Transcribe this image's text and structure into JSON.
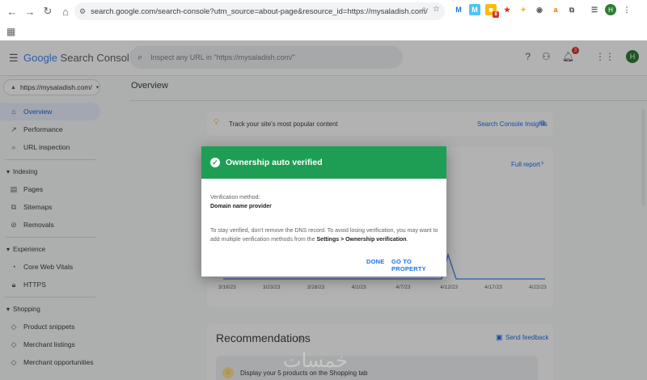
{
  "browser": {
    "url": "search.google.com/search-console?utm_source=about-page&resource_id=https://mysaladish.com/",
    "profile_initial": "H",
    "extension_badge": "8"
  },
  "app": {
    "logo_google": "Google",
    "logo_product": "Search Console",
    "search_placeholder": "Inspect any URL in \"https://mysaladish.com/\"",
    "notification_count": "3",
    "user_initial": "H"
  },
  "sidebar": {
    "property": "https://mysaladish.com/",
    "items": [
      {
        "label": "Overview"
      },
      {
        "label": "Performance"
      },
      {
        "label": "URL inspection"
      }
    ],
    "sections": [
      {
        "title": "Indexing",
        "items": [
          {
            "label": "Pages"
          },
          {
            "label": "Sitemaps"
          },
          {
            "label": "Removals"
          }
        ]
      },
      {
        "title": "Experience",
        "items": [
          {
            "label": "Core Web Vitals"
          },
          {
            "label": "HTTPS"
          }
        ]
      },
      {
        "title": "Shopping",
        "items": [
          {
            "label": "Product snippets"
          },
          {
            "label": "Merchant listings"
          },
          {
            "label": "Merchant opportunities"
          }
        ]
      }
    ]
  },
  "main": {
    "title": "Overview",
    "insights_text": "Track your site's most popular content",
    "insights_link": "Search Console Insights",
    "full_report": "Full report",
    "x_ticks": [
      "3/18/23",
      "3/23/23",
      "3/28/23",
      "4/2/23",
      "4/7/23",
      "4/12/23",
      "4/17/23",
      "4/22/23"
    ],
    "recommendations_title": "Recommendations",
    "send_feedback": "Send feedback",
    "rec_item": "Display your 5 products on the Shopping tab"
  },
  "dialog": {
    "title": "Ownership auto verified",
    "method_label": "Verification method:",
    "method_value": "Domain name provider",
    "note_part1": "To stay verified, don't remove the DNS record. To avoid losing verification, you may want to add multiple verification methods from the ",
    "note_bold": "Settings > Ownership verification",
    "note_part2": ".",
    "done_label": "DONE",
    "go_label": "GO TO PROPERTY"
  },
  "watermark": "خمسات"
}
